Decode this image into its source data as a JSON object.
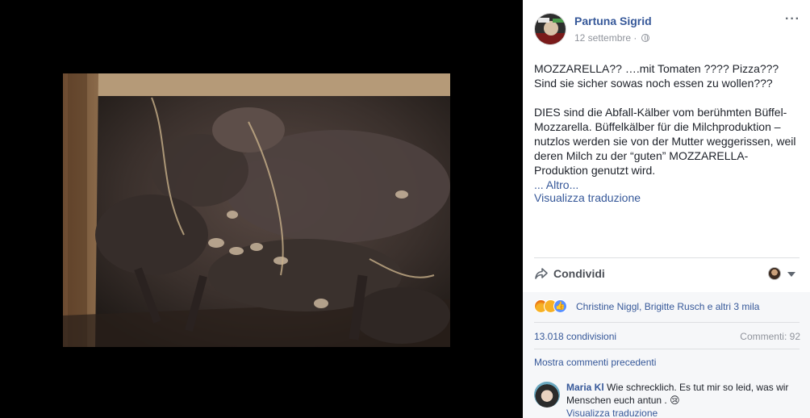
{
  "post": {
    "author": "Partuna Sigrid",
    "date": "12 settembre",
    "date_separator": "·",
    "more_label": "···",
    "text_p1": "MOZZARELLA?? ….mit Tomaten ???? Pizza??? Sind sie sicher sowas noch essen zu wollen???",
    "text_p2": "DIES sind die Abfall-Kälber vom berühmten Büffel-Mozzarella. Büffelkälber für die Milchproduktion – nutzlos werden sie von der Mutter weggerissen, weil deren Milch zu der “guten” MOZZARELLA-Produktion genutzt wird.",
    "more_link_prefix": "... ",
    "more_link": "Altro...",
    "translate": "Visualizza traduzione"
  },
  "actions": {
    "share_label": "Condividi"
  },
  "reactions": {
    "types": [
      "angry",
      "sad",
      "like"
    ],
    "names": "Christine Niggl, Brigitte Rusch e altri 3 mila"
  },
  "stats": {
    "shares": "13.018 condivisioni",
    "comments": "Commenti: 92"
  },
  "comments_section": {
    "show_previous": "Mostra commenti precedenti",
    "items": [
      {
        "author": "Maria Kl",
        "text": "Wie schrecklich. Es tut mir so leid, was wir Menschen euch antun . 😢",
        "translate": "Visualizza traduzione"
      }
    ]
  },
  "colors": {
    "link": "#365899",
    "viewer_bg": "#000000",
    "panel_bg": "#ffffff",
    "footer_bg": "#f6f7f9"
  }
}
